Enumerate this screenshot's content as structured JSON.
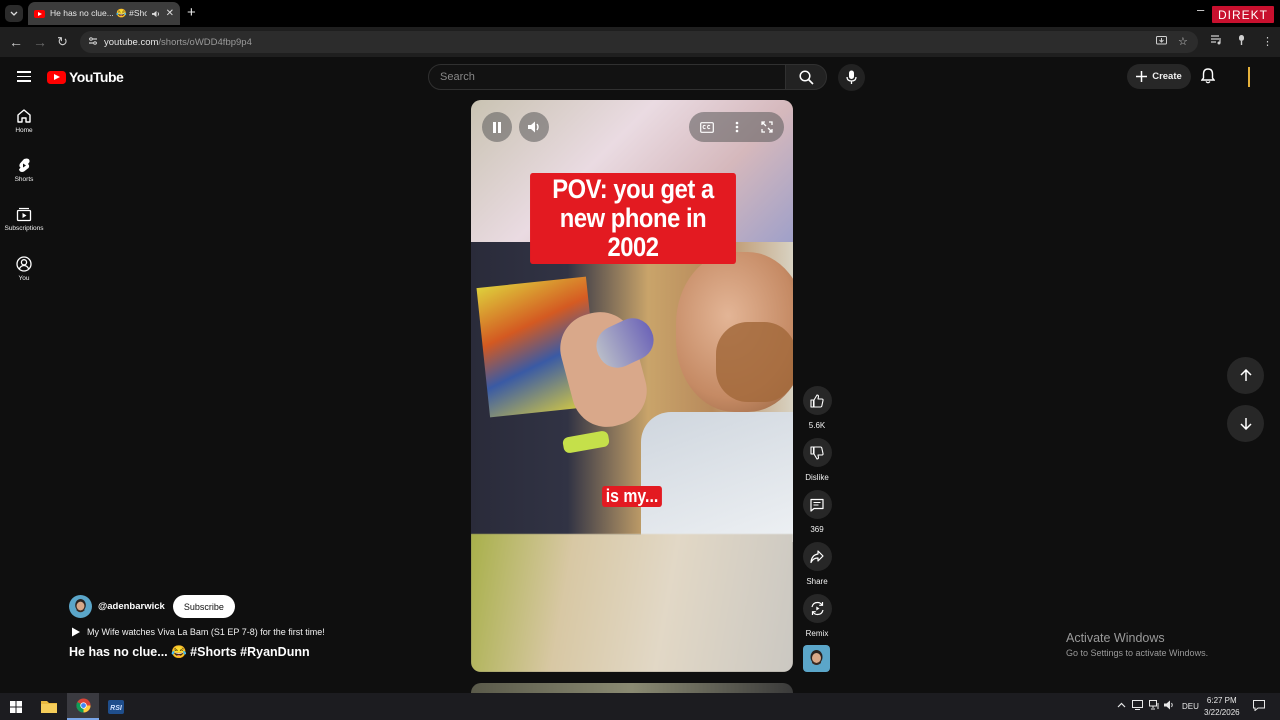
{
  "browser": {
    "tab_title": "He has no clue... 😂 #Shorts",
    "url_host": "youtube.com",
    "url_path": "/shorts/oWDD4fbp9p4",
    "badge": "DIREKT",
    "accent_color": "#c8102e"
  },
  "header": {
    "logo_text": "YouTube",
    "search_placeholder": "Search",
    "create_label": "Create"
  },
  "sidebar": {
    "items": [
      {
        "label": "Home",
        "icon": "home-icon"
      },
      {
        "label": "Shorts",
        "icon": "shorts-icon"
      },
      {
        "label": "Subscriptions",
        "icon": "subscriptions-icon"
      },
      {
        "label": "You",
        "icon": "you-icon"
      }
    ]
  },
  "video": {
    "caption_main": "POV: you get a new phone in 2002",
    "caption_sub": "is my...",
    "caption_color": "#e31a21"
  },
  "actions": {
    "likes": "5.6K",
    "dislike_label": "Dislike",
    "comments": "369",
    "share_label": "Share",
    "remix_label": "Remix"
  },
  "channel": {
    "handle": "@adenbarwick",
    "subscribe_label": "Subscribe",
    "related_video": "My Wife watches Viva La Bam (S1 EP 7-8) for the first time!",
    "short_title": "He has no clue... 😂 #Shorts #RyanDunn"
  },
  "watermark": {
    "line1": "Activate Windows",
    "line2": "Go to Settings to activate Windows."
  },
  "taskbar": {
    "language": "DEU",
    "time": "6:27 PM",
    "date": "3/22/2026"
  }
}
